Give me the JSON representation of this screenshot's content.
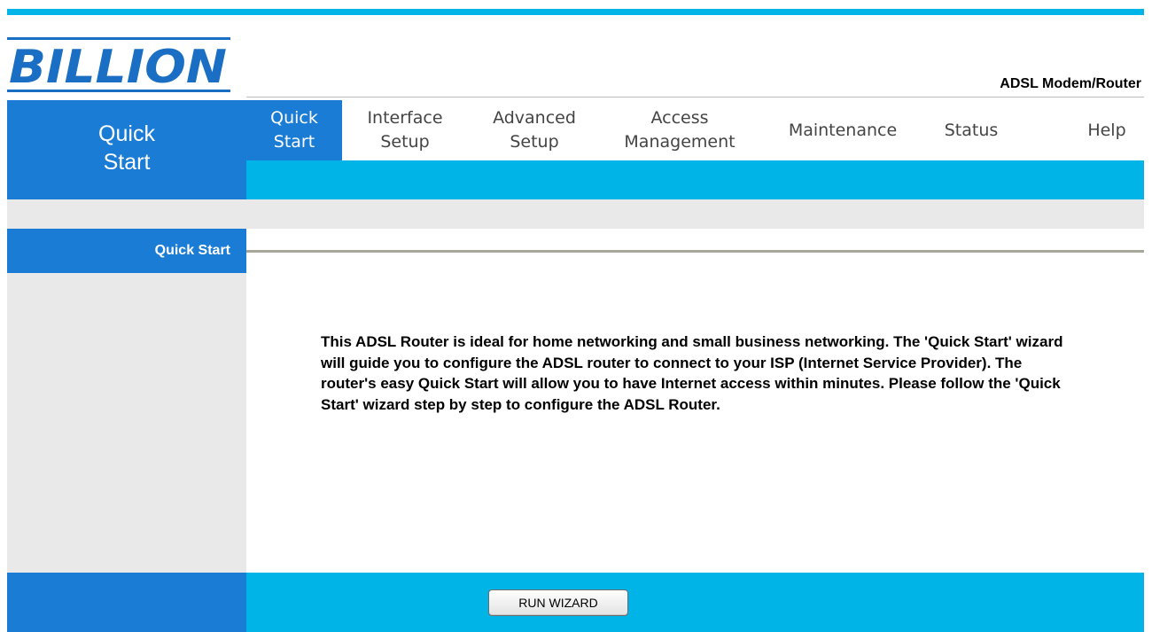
{
  "header": {
    "logo_text": "BILLION",
    "product_name": "ADSL Modem/Router"
  },
  "sidebar": {
    "title": [
      "Quick",
      "Start"
    ],
    "items": [
      {
        "label": "Quick Start",
        "active": true
      }
    ]
  },
  "nav": {
    "items": [
      {
        "lines": [
          "Quick",
          "Start"
        ],
        "active": true
      },
      {
        "lines": [
          "Interface",
          "Setup"
        ],
        "active": false
      },
      {
        "lines": [
          "Advanced",
          "Setup"
        ],
        "active": false
      },
      {
        "lines": [
          "Access",
          "Management"
        ],
        "active": false
      },
      {
        "lines": [
          "Maintenance"
        ],
        "active": false
      },
      {
        "lines": [
          "Status"
        ],
        "active": false
      },
      {
        "lines": [
          "Help"
        ],
        "active": false
      }
    ]
  },
  "main": {
    "description": "This ADSL Router is ideal for home networking and small business networking. The 'Quick Start' wizard will guide you to configure the ADSL router to connect to your ISP (Internet Service Provider). The router's easy Quick Start will allow you to have Internet access within minutes. Please follow the 'Quick Start' wizard step by step to configure the ADSL Router."
  },
  "footer": {
    "run_wizard_label": "RUN WIZARD"
  },
  "colors": {
    "primary_blue": "#1a7cd4",
    "accent_cyan": "#00b4e8",
    "panel_grey": "#e9e9e9"
  }
}
